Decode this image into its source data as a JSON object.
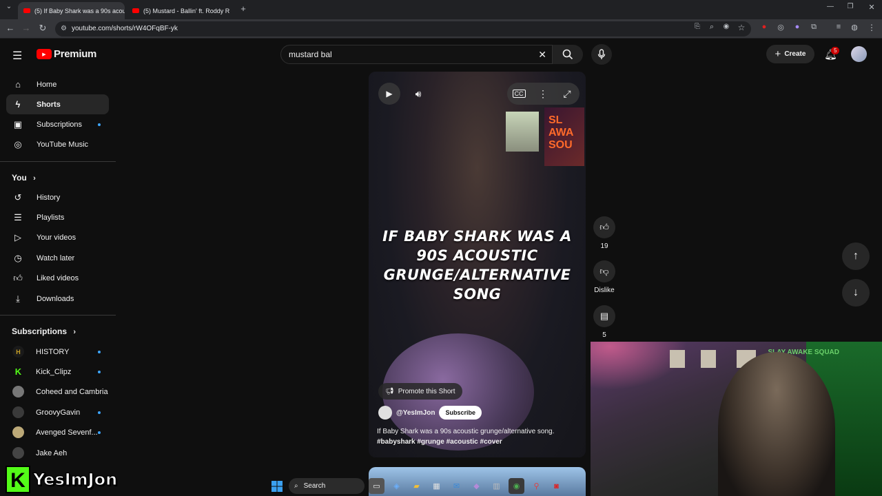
{
  "browser": {
    "tabs": [
      {
        "title": "(5) If Baby Shark was a 90s acou"
      },
      {
        "title": "(5) Mustard - Ballin' ft. Roddy R"
      }
    ],
    "url": "youtube.com/shorts/rW4OFqBF-yk"
  },
  "header": {
    "logo_text": "Premium",
    "search_value": "mustard bal",
    "create_label": "Create",
    "notification_count": "5"
  },
  "sidebar": {
    "main": [
      {
        "label": "Home",
        "icon": "home-icon"
      },
      {
        "label": "Shorts",
        "icon": "shorts-icon",
        "selected": true
      },
      {
        "label": "Subscriptions",
        "icon": "subscriptions-icon"
      },
      {
        "label": "YouTube Music",
        "icon": "youtube-music-icon"
      }
    ],
    "you_title": "You",
    "you": [
      {
        "label": "History",
        "icon": "history-icon"
      },
      {
        "label": "Playlists",
        "icon": "playlists-icon"
      },
      {
        "label": "Your videos",
        "icon": "your-videos-icon"
      },
      {
        "label": "Watch later",
        "icon": "watch-later-icon"
      },
      {
        "label": "Liked videos",
        "icon": "liked-videos-icon"
      },
      {
        "label": "Downloads",
        "icon": "downloads-icon"
      }
    ],
    "subs_title": "Subscriptions",
    "subs": [
      {
        "label": "HISTORY",
        "avatar": "H",
        "color": "#1a1a1a",
        "fg": "#c9a227"
      },
      {
        "label": "Kick_Clipz",
        "avatar": "K",
        "color": "#0f0f0f",
        "fg": "#53fc18"
      },
      {
        "label": "Coheed and Cambria",
        "avatar": "",
        "color": "#777777",
        "fg": "#ffffff"
      },
      {
        "label": "GroovyGavin",
        "avatar": "",
        "color": "#3a3a3a",
        "fg": "#ffffff"
      },
      {
        "label": "Avenged Sevenf...",
        "avatar": "",
        "color": "#bca978",
        "fg": "#000000"
      },
      {
        "label": "Jake Aeh",
        "avatar": "",
        "color": "#444444",
        "fg": "#ffffff"
      }
    ]
  },
  "short": {
    "caption": "IF BABY SHARK WAS A 90S ACOUSTIC GRUNGE/ALTERNATIVE SONG",
    "promote_label": "Promote this Short",
    "channel": "@YesImJon",
    "subscribe_label": "Subscribe",
    "description": "If Baby Shark was a 90s acoustic grunge/alternative song.",
    "tags": "#babyshark  #grunge #acoustic #cover",
    "poster_text": "SL AWA SOU"
  },
  "actions": {
    "like_count": "19",
    "dislike_label": "Dislike",
    "comment_count": "5"
  },
  "webcam": {
    "poster_text": "SLAY AWAKE SQUAD"
  },
  "watermark": {
    "text": "YesImJon"
  },
  "taskbar": {
    "search_label": "Search"
  }
}
